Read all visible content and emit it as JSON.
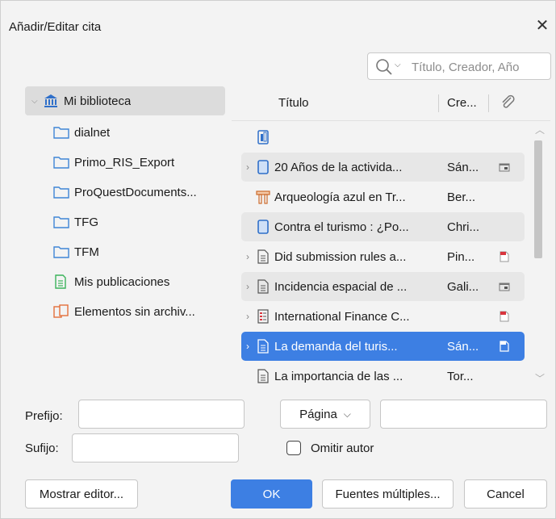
{
  "dialog": {
    "title": "Añadir/Editar cita",
    "close_glyph": "✕"
  },
  "search": {
    "placeholder": "Título, Creador, Año",
    "icon": "search-icon",
    "mode_caret": "⌵"
  },
  "tree": [
    {
      "label": "Mi biblioteca",
      "icon": "library-icon",
      "twisty": "⌵",
      "selected": true
    },
    {
      "label": "dialnet",
      "icon": "folder-icon"
    },
    {
      "label": "Primo_RIS_Export",
      "icon": "folder-icon"
    },
    {
      "label": "ProQuestDocuments...",
      "icon": "folder-icon"
    },
    {
      "label": "TFG",
      "icon": "folder-icon"
    },
    {
      "label": "TFM",
      "icon": "folder-icon"
    },
    {
      "label": "Mis publicaciones",
      "icon": "publications-icon"
    },
    {
      "label": "Elementos sin archiv...",
      "icon": "unfiled-items-icon"
    }
  ],
  "list": {
    "headers": {
      "title": "Título",
      "creator": "Cre...",
      "attachment_icon": "paperclip-icon"
    },
    "rows": [
      {
        "twisty": "",
        "icon": "book-section-icon",
        "title": "",
        "creator": "",
        "attachment": "",
        "style": "plain"
      },
      {
        "twisty": "›",
        "icon": "book-icon",
        "title": "20 Años de la activida...",
        "creator": "Sán...",
        "attachment": "snapshot-icon",
        "style": "alt"
      },
      {
        "twisty": "",
        "icon": "thesis-icon",
        "title": "Arqueología azul en Tr...",
        "creator": "Ber...",
        "attachment": "",
        "style": "plain"
      },
      {
        "twisty": "",
        "icon": "book-icon",
        "title": "Contra el turismo : ¿Po...",
        "creator": "Chri...",
        "attachment": "",
        "style": "alt"
      },
      {
        "twisty": "›",
        "icon": "document-icon",
        "title": "Did submission rules a...",
        "creator": "Pin...",
        "attachment": "pdf-icon",
        "style": "plain"
      },
      {
        "twisty": "›",
        "icon": "document-icon",
        "title": "Incidencia espacial de ...",
        "creator": "Gali...",
        "attachment": "snapshot-icon",
        "style": "alt"
      },
      {
        "twisty": "›",
        "icon": "report-icon",
        "title": "International Finance C...",
        "creator": "",
        "attachment": "pdf-icon",
        "style": "plain"
      },
      {
        "twisty": "›",
        "icon": "document-icon",
        "title": "La demanda del turis...",
        "creator": "Sán...",
        "attachment": "pdf-icon",
        "style": "selected"
      },
      {
        "twisty": "",
        "icon": "document-icon",
        "title": "La importancia de las ...",
        "creator": "Tor...",
        "attachment": "",
        "style": "plain"
      }
    ]
  },
  "scrollbar": {
    "up": "︿",
    "down": "﹀"
  },
  "form": {
    "prefix_label": "Prefijo:",
    "prefix_value": "",
    "suffix_label": "Sufijo:",
    "suffix_value": "",
    "locator_select": "Página",
    "locator_caret": "⌵",
    "locator_value": "",
    "omit_author_label": "Omitir autor",
    "omit_author_checked": false
  },
  "buttons": {
    "show_editor": "Mostrar editor...",
    "ok": "OK",
    "multiple_sources": "Fuentes múltiples...",
    "cancel": "Cancel"
  },
  "colors": {
    "accent": "#3d7fe3",
    "folder": "#3f86d6",
    "pdf": "#d9363e",
    "publications": "#3bb35a",
    "unfiled": "#e36f3a",
    "thesis": "#cc6a2a"
  }
}
